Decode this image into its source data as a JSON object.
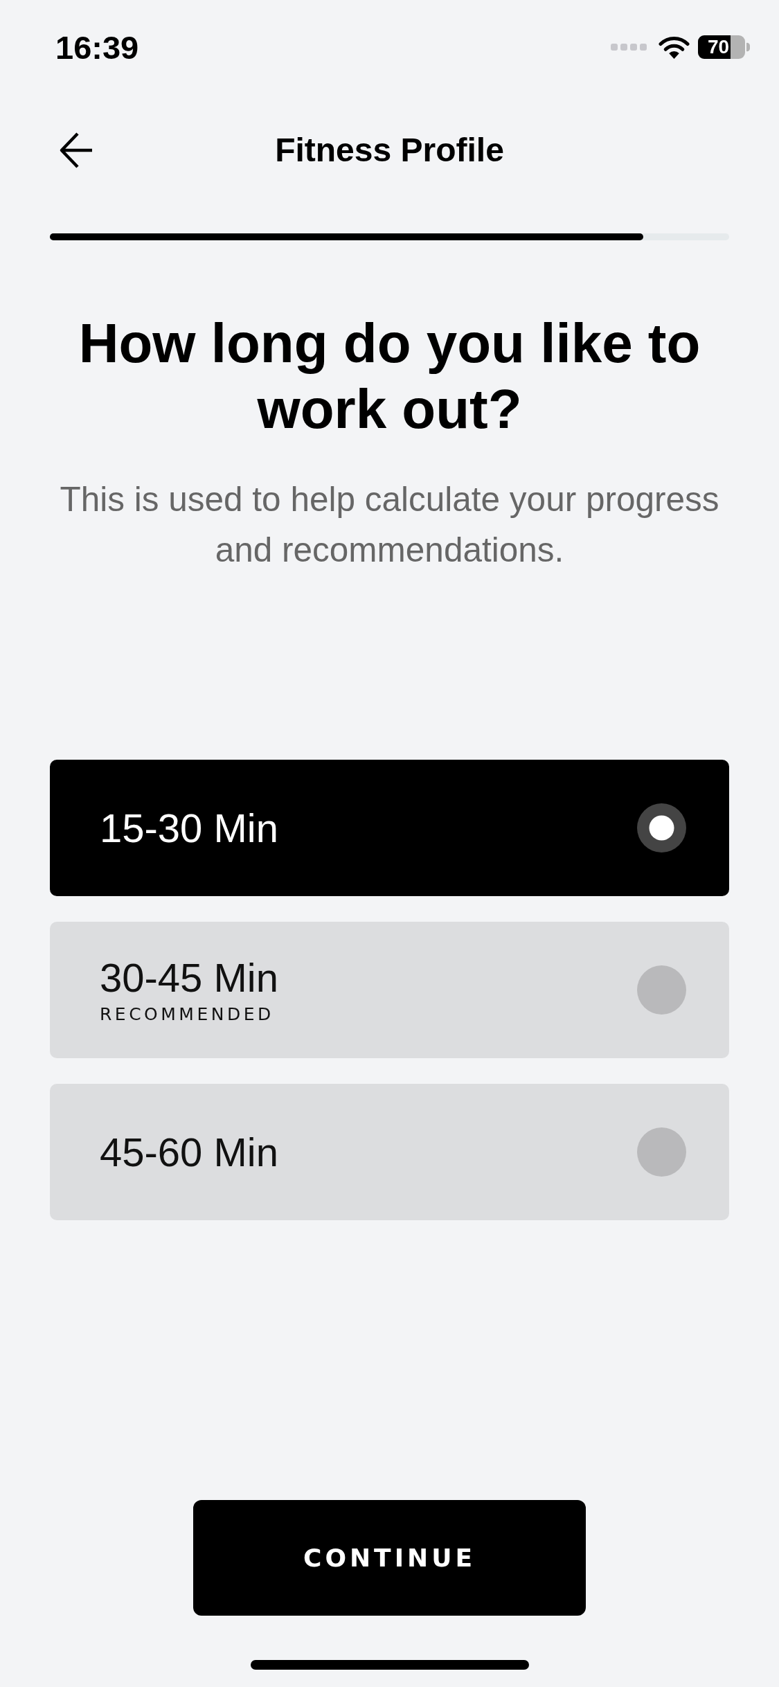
{
  "status_bar": {
    "time": "16:39",
    "battery": "70"
  },
  "header": {
    "title": "Fitness Profile"
  },
  "progress": {
    "level": 0.874
  },
  "question": {
    "title": "How long do you like to work out?",
    "subtitle": "This is used to help calculate your progress and recommendations."
  },
  "options": [
    {
      "label": "15-30 Min",
      "selected": true
    },
    {
      "label": "30-45 Min",
      "tag": "RECOMMENDED",
      "selected": false
    },
    {
      "label": "45-60 Min",
      "selected": false
    }
  ],
  "continue_button": {
    "label": "CONTINUE"
  }
}
